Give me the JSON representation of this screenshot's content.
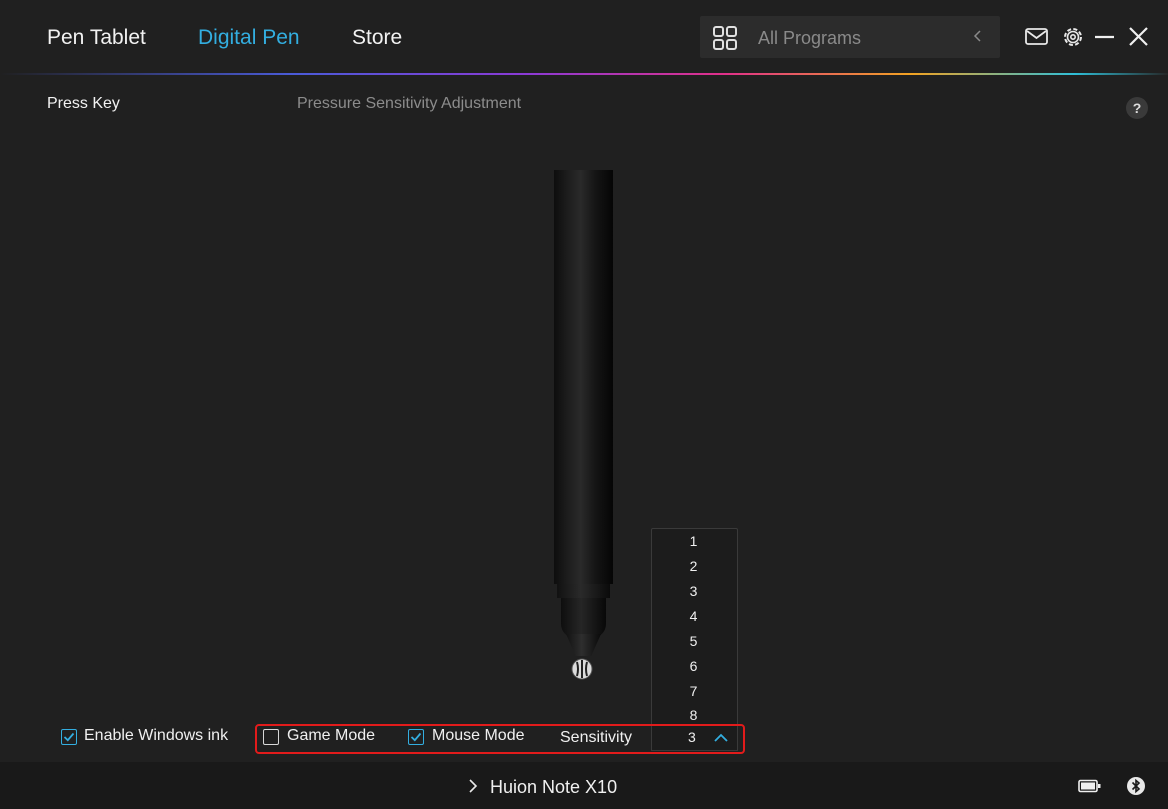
{
  "header": {
    "tabs": [
      {
        "label": "Pen Tablet",
        "active": false
      },
      {
        "label": "Digital Pen",
        "active": true
      },
      {
        "label": "Store",
        "active": false
      }
    ],
    "program_search": {
      "placeholder": "All Programs",
      "icon": "grid-icon",
      "back_icon": "chevron-left-icon"
    },
    "actions": [
      "mail-icon",
      "settings-icon",
      "minimize-icon",
      "close-icon"
    ]
  },
  "subtabs": [
    {
      "label": "Press Key",
      "active": true
    },
    {
      "label": "Pressure Sensitivity Adjustment",
      "active": false
    }
  ],
  "help_label": "?",
  "sensitivity_dropdown": {
    "options": [
      "1",
      "2",
      "3",
      "4",
      "5",
      "6",
      "7",
      "8"
    ],
    "selected": "3",
    "expanded": true
  },
  "options": {
    "windows_ink": {
      "label": "Enable Windows ink",
      "checked": true
    },
    "game_mode": {
      "label": "Game Mode",
      "checked": false
    },
    "mouse_mode": {
      "label": "Mouse Mode",
      "checked": true
    },
    "sensitivity_label": "Sensitivity"
  },
  "footer": {
    "device_name": "Huion Note X10",
    "icons": [
      "battery-icon",
      "bluetooth-icon"
    ]
  },
  "colors": {
    "accent": "#33aee0",
    "background": "#202020",
    "highlight": "#e21b1b"
  }
}
